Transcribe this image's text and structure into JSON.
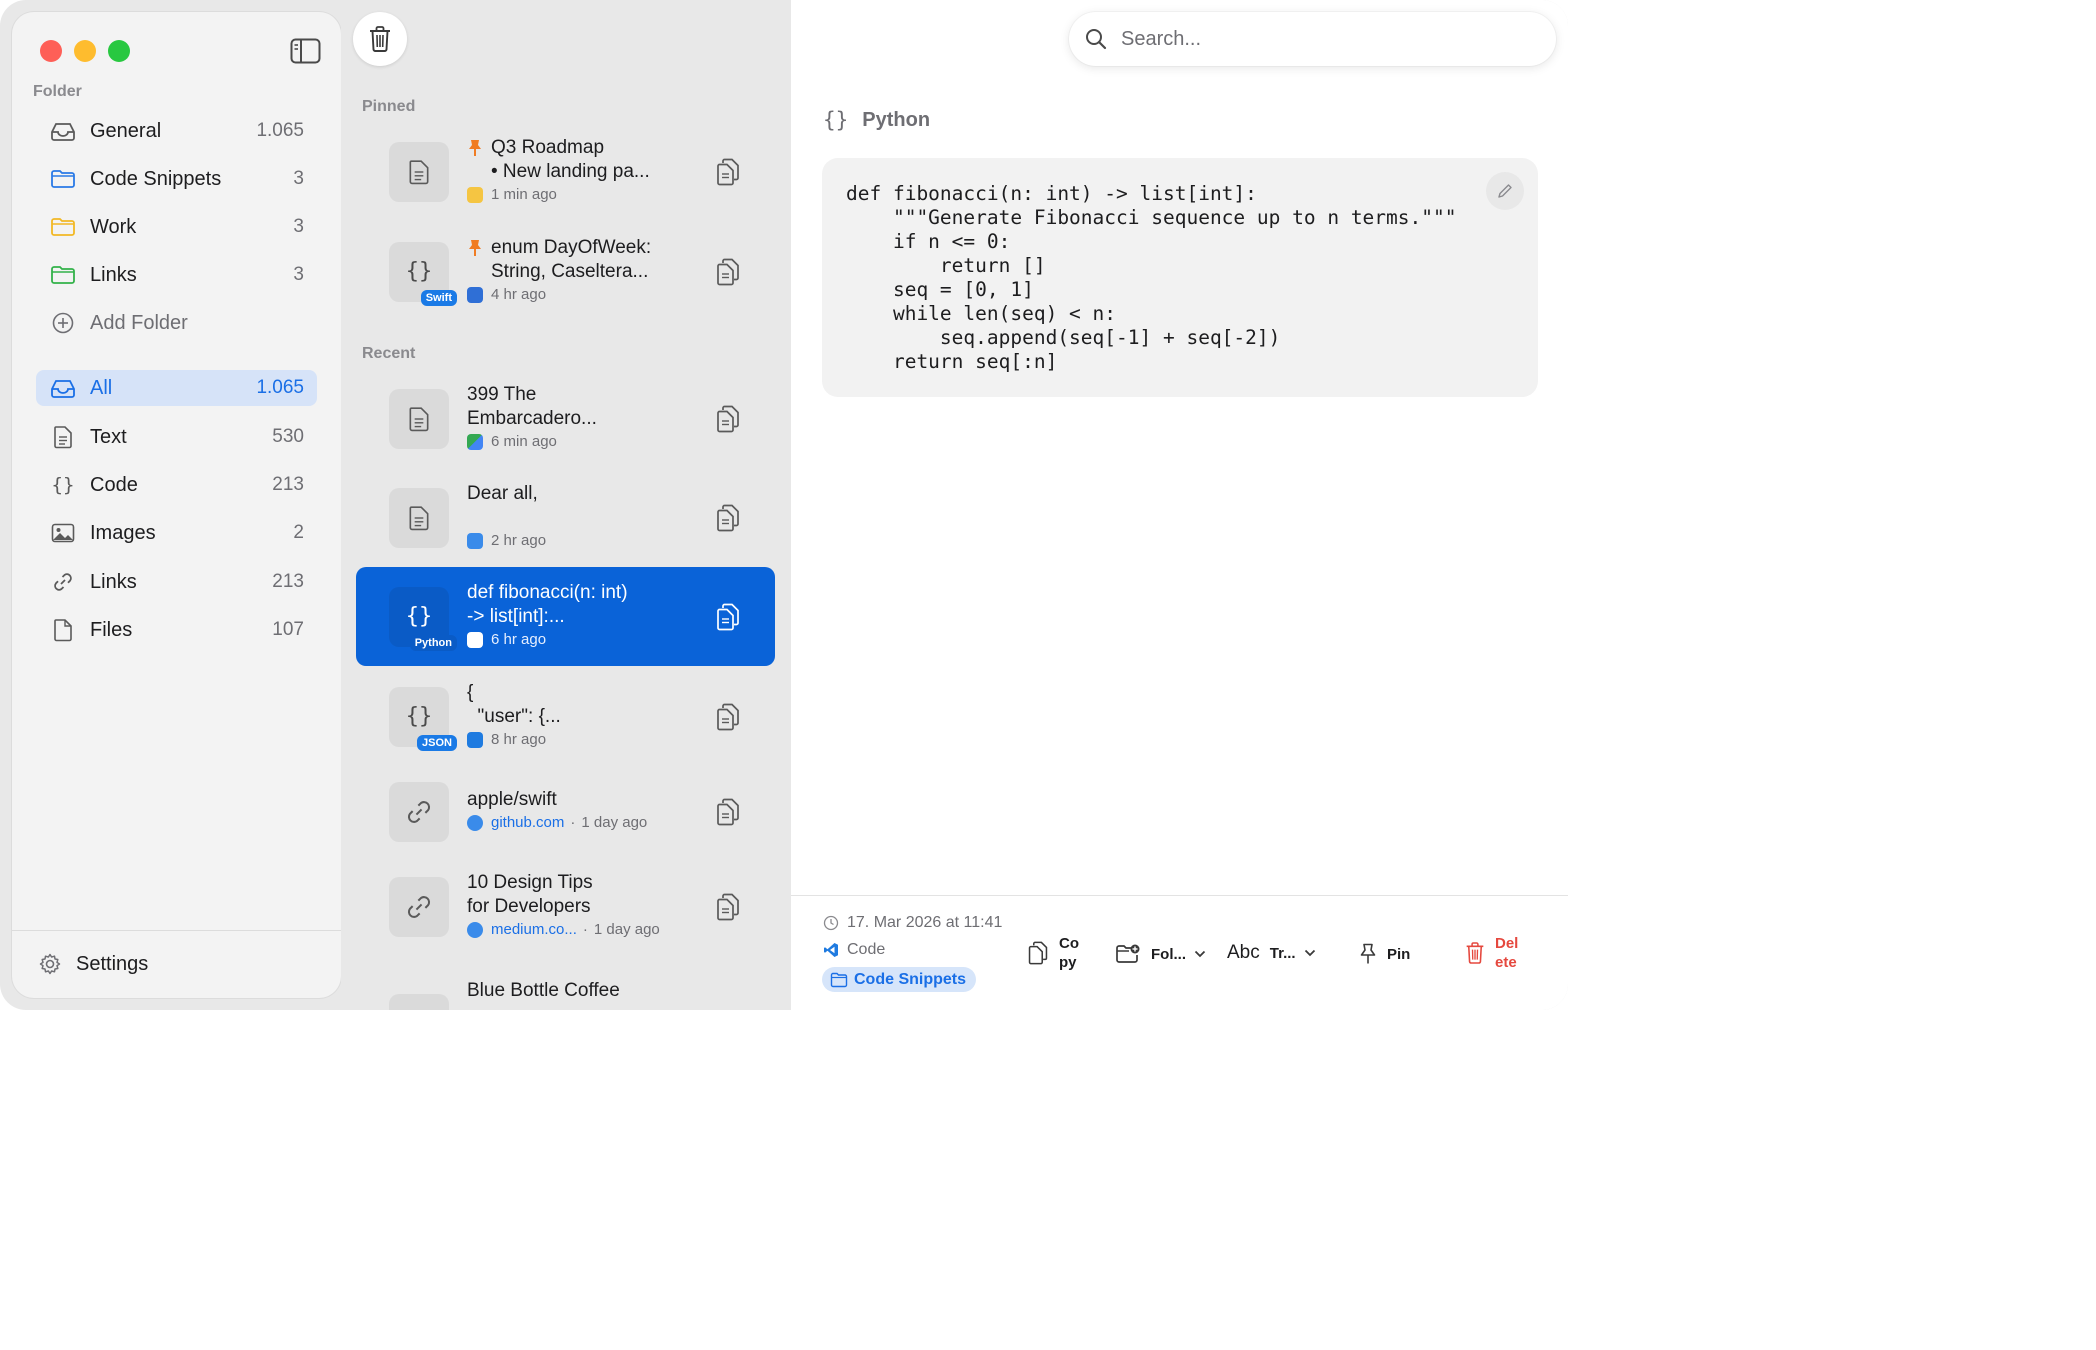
{
  "sidebar": {
    "folder_section_label": "Folder",
    "folders": [
      {
        "label": "General",
        "count": "1.065",
        "icon": "tray-icon"
      },
      {
        "label": "Code Snippets",
        "count": "3",
        "icon": "folder-blue-icon"
      },
      {
        "label": "Work",
        "count": "3",
        "icon": "folder-yellow-icon"
      },
      {
        "label": "Links",
        "count": "3",
        "icon": "folder-green-icon"
      }
    ],
    "add_folder_label": "Add Folder",
    "filters": [
      {
        "label": "All",
        "count": "1.065",
        "icon": "tray-icon",
        "active": true
      },
      {
        "label": "Text",
        "count": "530",
        "icon": "document-icon"
      },
      {
        "label": "Code",
        "count": "213",
        "icon": "braces-icon"
      },
      {
        "label": "Images",
        "count": "2",
        "icon": "image-icon"
      },
      {
        "label": "Links",
        "count": "213",
        "icon": "link-icon"
      },
      {
        "label": "Files",
        "count": "107",
        "icon": "file-icon"
      }
    ],
    "settings_label": "Settings"
  },
  "list": {
    "pinned_label": "Pinned",
    "recent_label": "Recent",
    "pinned": [
      {
        "line1": "Q3 Roadmap",
        "line2": "• New landing pa...",
        "time": "1 min ago",
        "kind": "text",
        "source_color": "#f5c542"
      },
      {
        "line1": "enum DayOfWeek:",
        "line2": "String, Caseltera...",
        "time": "4 hr ago",
        "kind": "code",
        "badge": "Swift",
        "source_color": "#2f6fd6"
      }
    ],
    "recent": [
      {
        "line1": "399 The",
        "line2": "Embarcadero...",
        "time": "6 min ago",
        "kind": "text",
        "source_color": "#34a853"
      },
      {
        "line1": "Dear all,",
        "line2": "",
        "time": "2 hr ago",
        "kind": "text",
        "source_color": "#3a8bea"
      },
      {
        "line1": "def fibonacci(n: int)",
        "line2": "-> list[int]:...",
        "time": "6 hr ago",
        "kind": "code",
        "badge": "Python",
        "selected": true,
        "source_color": "#1f7be0"
      },
      {
        "line1": "{",
        "line2": "  \"user\": {...",
        "time": "8 hr ago",
        "kind": "code",
        "badge": "JSON",
        "source_color": "#1f7be0"
      },
      {
        "line1": "apple/swift",
        "line2": "",
        "link": "github.com",
        "time": "1 day ago",
        "kind": "link",
        "source_color": "#3a8bea"
      },
      {
        "line1": "10 Design Tips",
        "line2": "for Developers",
        "link": "medium.co...",
        "time": "1 day ago",
        "kind": "link",
        "source_color": "#3a8bea"
      },
      {
        "line1": "Blue Bottle Coffee",
        "line2": "",
        "time": "",
        "kind": "link",
        "source_color": "#3a8bea"
      }
    ]
  },
  "detail": {
    "search_placeholder": "Search...",
    "language": "Python",
    "code": "def fibonacci(n: int) -> list[int]:\n    \"\"\"Generate Fibonacci sequence up to n terms.\"\"\"\n    if n <= 0:\n        return []\n    seq = [0, 1]\n    while len(seq) < n:\n        seq.append(seq[-1] + seq[-2])\n    return seq[:n]",
    "timestamp": "17. Mar 2026 at 11:41",
    "source_app": "Code",
    "folder": "Code Snippets",
    "actions": {
      "copy": [
        "Co",
        "py"
      ],
      "folder": "Fol...",
      "transform_abc": "Abc",
      "transform": "Tr...",
      "pin": "Pin",
      "delete": [
        "Del",
        "ete"
      ]
    }
  },
  "colors": {
    "accent": "#1a6fe6",
    "selected_row": "#0a63d8",
    "danger": "#e5483e"
  }
}
